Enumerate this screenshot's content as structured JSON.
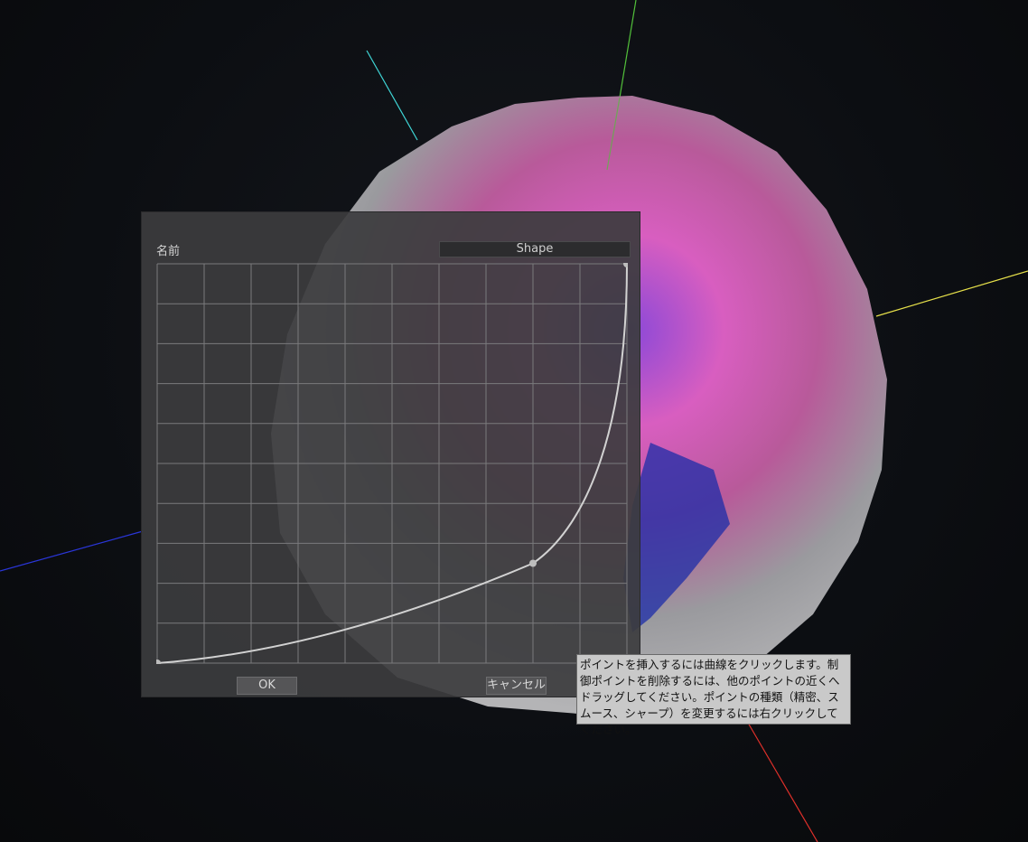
{
  "scene": {
    "axis_colors": {
      "x": "#e0302a",
      "y": "#52c03a",
      "z": "#2a36d8",
      "diag1": "#3fd6d6",
      "diag2": "#e6e04a"
    },
    "sphere_colors": [
      "#b0b0b0",
      "#a05aa8",
      "#d65cb6",
      "#8844d6",
      "#1c2c9c"
    ]
  },
  "dialog": {
    "name_label": "名前",
    "name_value": "Shape",
    "ok_label": "OK",
    "cancel_label": "キャンセル",
    "curve": {
      "grid_cols": 10,
      "grid_rows": 10,
      "control_points": [
        {
          "x": 0.0,
          "y": 0.0
        },
        {
          "x": 0.8,
          "y": 0.25
        },
        {
          "x": 1.0,
          "y": 1.0
        }
      ]
    }
  },
  "tooltip": {
    "text": "ポイントを挿入するには曲線をクリックします。制御ポイントを削除するには、他のポイントの近くへドラッグしてください。ポイントの種類（精密、スムース、シャープ）を変更するには右クリックしてください。"
  }
}
